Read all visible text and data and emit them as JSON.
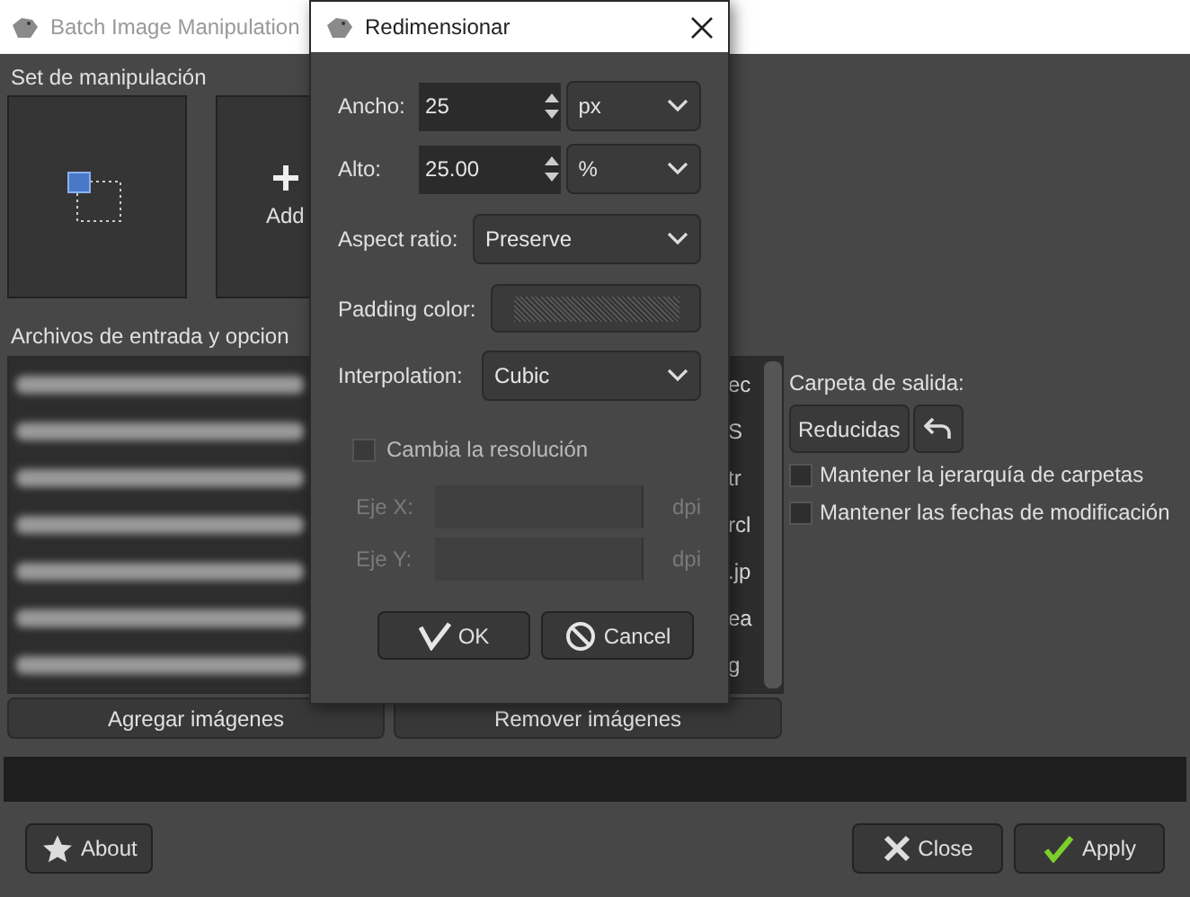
{
  "window": {
    "title": "Batch Image Manipulation"
  },
  "manipulation_set": {
    "label": "Set de manipulación",
    "add_label": "Add"
  },
  "input_files": {
    "label": "Archivos de entrada y opcion",
    "rows": [
      {
        "tail": "ec"
      },
      {
        "tail": "S"
      },
      {
        "tail": "tr"
      },
      {
        "tail": "rcl"
      },
      {
        "tail": ".jp"
      },
      {
        "tail": "ea"
      },
      {
        "tail": "g"
      }
    ],
    "buttons": [
      "Agregar imágenes",
      "Remover imágenes"
    ]
  },
  "output": {
    "label": "Carpeta de salida:",
    "folder": "Reducidas",
    "options": [
      {
        "label": "Mantener la jerarquía de carpetas",
        "checked": false
      },
      {
        "label": "Mantener las fechas de modificación",
        "checked": false
      }
    ]
  },
  "progress": {
    "level": 0
  },
  "footer": {
    "about": "About",
    "close": "Close",
    "apply": "Apply"
  },
  "dialog": {
    "title": "Redimensionar",
    "width": {
      "label": "Ancho:",
      "value": "25",
      "unit": "px"
    },
    "height": {
      "label": "Alto:",
      "value": "25.00",
      "unit": "%"
    },
    "aspect": {
      "label": "Aspect ratio:",
      "value": "Preserve"
    },
    "padding": {
      "label": "Padding color:"
    },
    "interpolation": {
      "label": "Interpolation:",
      "value": "Cubic"
    },
    "resolution": {
      "label": "Cambia la resolución",
      "checked": false
    },
    "axis_x": {
      "label": "Eje X:",
      "unit": "dpi",
      "disabled": true
    },
    "axis_y": {
      "label": "Eje Y:",
      "unit": "dpi",
      "disabled": true
    },
    "ok": "OK",
    "cancel": "Cancel"
  }
}
